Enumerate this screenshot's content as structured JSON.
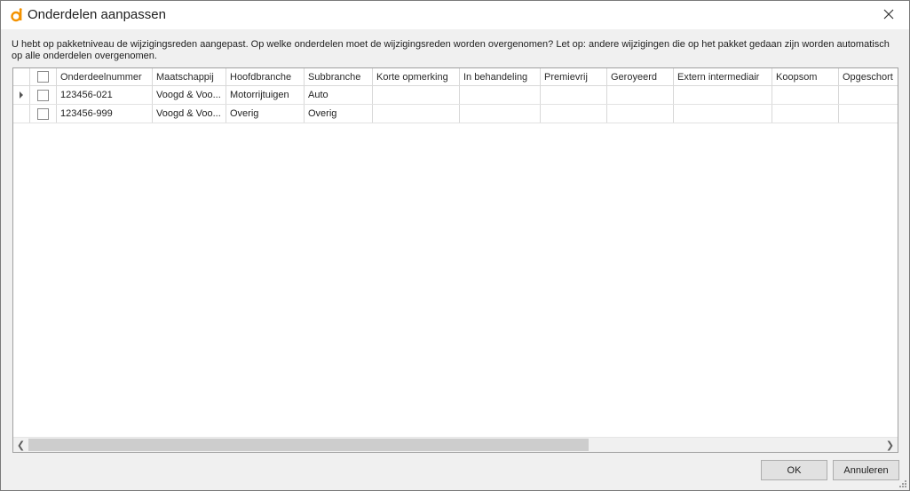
{
  "window": {
    "title": "Onderdelen aanpassen",
    "icon": "app-logo-icon",
    "accent_color": "#f39200"
  },
  "message": "U hebt op pakketniveau de wijzigingsreden aangepast. Op welke onderdelen moet de wijzigingsreden worden overgenomen? Let op: andere wijzigingen die op het pakket gedaan zijn worden automatisch op alle onderdelen overgenomen.",
  "grid": {
    "columns": [
      "Onderdeelnummer",
      "Maatschappij",
      "Hoofdbranche",
      "Subbranche",
      "Korte opmerking",
      "In behandeling",
      "Premievrij",
      "Geroyeerd",
      "Extern intermediair",
      "Koopsom",
      "Opgeschort"
    ],
    "rows": [
      {
        "selected": false,
        "current": true,
        "cells": [
          "123456-021",
          "Voogd & Voo...",
          "Motorrijtuigen",
          "Auto",
          "",
          "",
          "",
          "",
          "",
          "",
          ""
        ]
      },
      {
        "selected": false,
        "current": false,
        "cells": [
          "123456-999",
          "Voogd & Voo...",
          "Overig",
          "Overig",
          "",
          "",
          "",
          "",
          "",
          "",
          ""
        ]
      }
    ]
  },
  "buttons": {
    "ok": "OK",
    "cancel": "Annuleren"
  }
}
